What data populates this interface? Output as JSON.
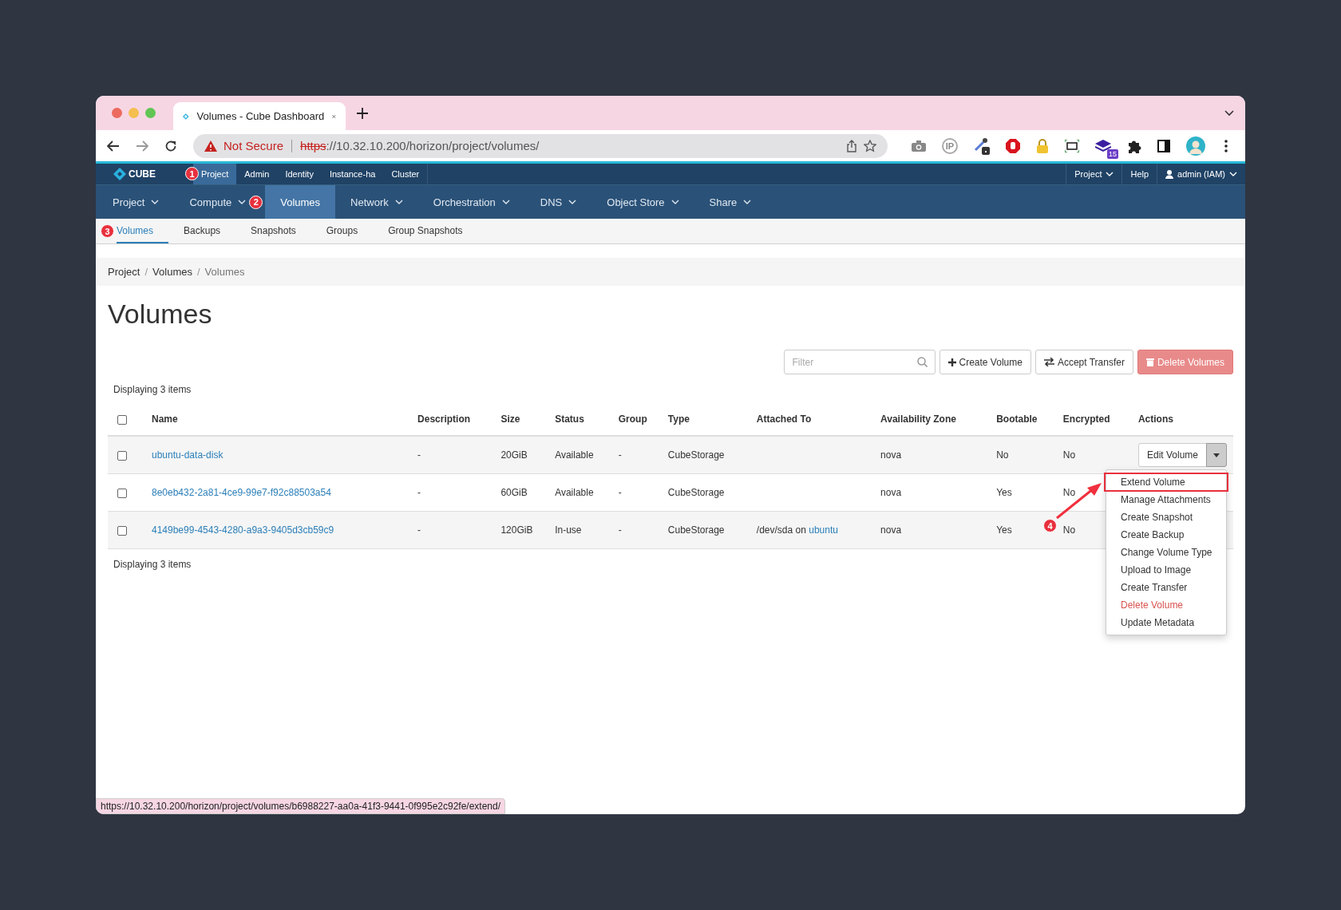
{
  "browser": {
    "tab": {
      "title": "Volumes - Cube Dashboard"
    },
    "address": {
      "security": "Not Secure",
      "scheme": "https",
      "rest": "://10.32.10.200/horizon/project/volumes/"
    },
    "extensions": [
      {
        "kind": "camera"
      },
      {
        "kind": "ip",
        "label": "IP"
      },
      {
        "kind": "dropper"
      },
      {
        "kind": "stop"
      },
      {
        "kind": "lock"
      },
      {
        "kind": "frame"
      },
      {
        "kind": "stack",
        "badge": "15"
      },
      {
        "kind": "puzzle"
      },
      {
        "kind": "sidebar"
      },
      {
        "kind": "avatar"
      }
    ]
  },
  "top_nav": {
    "brand": "CUBE",
    "items": [
      {
        "label": "Project",
        "selected": true,
        "callout": "1"
      },
      {
        "label": "Admin",
        "selected": false
      },
      {
        "label": "Identity",
        "selected": false
      },
      {
        "label": "Instance-ha",
        "selected": false
      },
      {
        "label": "Cluster",
        "selected": false
      }
    ],
    "right": [
      {
        "label": "Project",
        "kind": "menu"
      },
      {
        "label": "Help",
        "kind": "link"
      },
      {
        "label": "admin (IAM)",
        "kind": "user"
      }
    ]
  },
  "main_nav": [
    {
      "label": "Project",
      "selected": false,
      "dropdown": true
    },
    {
      "label": "Compute",
      "selected": false,
      "dropdown": true
    },
    {
      "label": "Volumes",
      "selected": true,
      "dropdown": false,
      "callout": "2"
    },
    {
      "label": "Network",
      "selected": false,
      "dropdown": true
    },
    {
      "label": "Orchestration",
      "selected": false,
      "dropdown": true
    },
    {
      "label": "DNS",
      "selected": false,
      "dropdown": true
    },
    {
      "label": "Object Store",
      "selected": false,
      "dropdown": true
    },
    {
      "label": "Share",
      "selected": false,
      "dropdown": true
    }
  ],
  "sub_tabs": [
    {
      "label": "Volumes",
      "selected": true,
      "callout": "3"
    },
    {
      "label": "Backups",
      "selected": false
    },
    {
      "label": "Snapshots",
      "selected": false
    },
    {
      "label": "Groups",
      "selected": false
    },
    {
      "label": "Group Snapshots",
      "selected": false
    }
  ],
  "breadcrumb": {
    "separator": "/",
    "items": [
      "Project",
      "Volumes",
      "Volumes"
    ]
  },
  "heading": "Volumes",
  "toolbar": {
    "filter": {
      "placeholder": "Filter"
    },
    "buttons": [
      {
        "label": "Create Volume",
        "kind": "create",
        "disabled": false
      },
      {
        "label": "Accept Transfer",
        "kind": "transfer",
        "disabled": false
      },
      {
        "label": "Delete Volumes",
        "kind": "delete",
        "disabled": true
      }
    ]
  },
  "table": {
    "count_top": "Displaying 3 items",
    "select_all": {
      "checked": false
    },
    "columns": [
      "Name",
      "Description",
      "Size",
      "Status",
      "Group",
      "Type",
      "Attached To",
      "Availability Zone",
      "Bootable",
      "Encrypted",
      "Actions"
    ],
    "rows": [
      {
        "checked": false,
        "name": "ubuntu-data-disk",
        "description": "-",
        "size": "20GiB",
        "status": "Available",
        "group": "-",
        "type": "CubeStorage",
        "availability_zone": "nova",
        "bootable": "No",
        "encrypted": "No",
        "action": {
          "label": "Edit Volume",
          "open": true
        }
      },
      {
        "checked": false,
        "name": "8e0eb432-2a81-4ce9-99e7-f92c88503a54",
        "description": "-",
        "size": "60GiB",
        "status": "Available",
        "group": "-",
        "type": "CubeStorage",
        "availability_zone": "nova",
        "bootable": "Yes",
        "encrypted": "No"
      },
      {
        "checked": false,
        "name": "4149be99-4543-4280-a9a3-9405d3cb59c9",
        "description": "-",
        "size": "120GiB",
        "status": "In-use",
        "group": "-",
        "type": "CubeStorage",
        "attached_to": {
          "text": "/dev/sda on",
          "link": "ubuntu"
        },
        "availability_zone": "nova",
        "bootable": "Yes",
        "encrypted": "No"
      }
    ],
    "count_bottom": "Displaying 3 items"
  },
  "action_menu": {
    "callout": "4",
    "items": [
      {
        "label": "Extend Volume",
        "kind": "normal",
        "highlighted": true
      },
      {
        "label": "Manage Attachments",
        "kind": "normal",
        "highlighted": false
      },
      {
        "label": "Create Snapshot",
        "kind": "normal",
        "highlighted": false
      },
      {
        "label": "Create Backup",
        "kind": "normal",
        "highlighted": false
      },
      {
        "label": "Change Volume Type",
        "kind": "normal",
        "highlighted": false
      },
      {
        "label": "Upload to Image",
        "kind": "normal",
        "highlighted": false
      },
      {
        "label": "Create Transfer",
        "kind": "normal",
        "highlighted": false
      },
      {
        "label": "Delete Volume",
        "kind": "danger",
        "highlighted": false
      },
      {
        "label": "Update Metadata",
        "kind": "normal",
        "highlighted": false
      }
    ]
  },
  "status_url": "https://10.32.10.200/horizon/project/volumes/b6988227-aa0a-41f3-9441-0f995e2c92fe/extend/"
}
